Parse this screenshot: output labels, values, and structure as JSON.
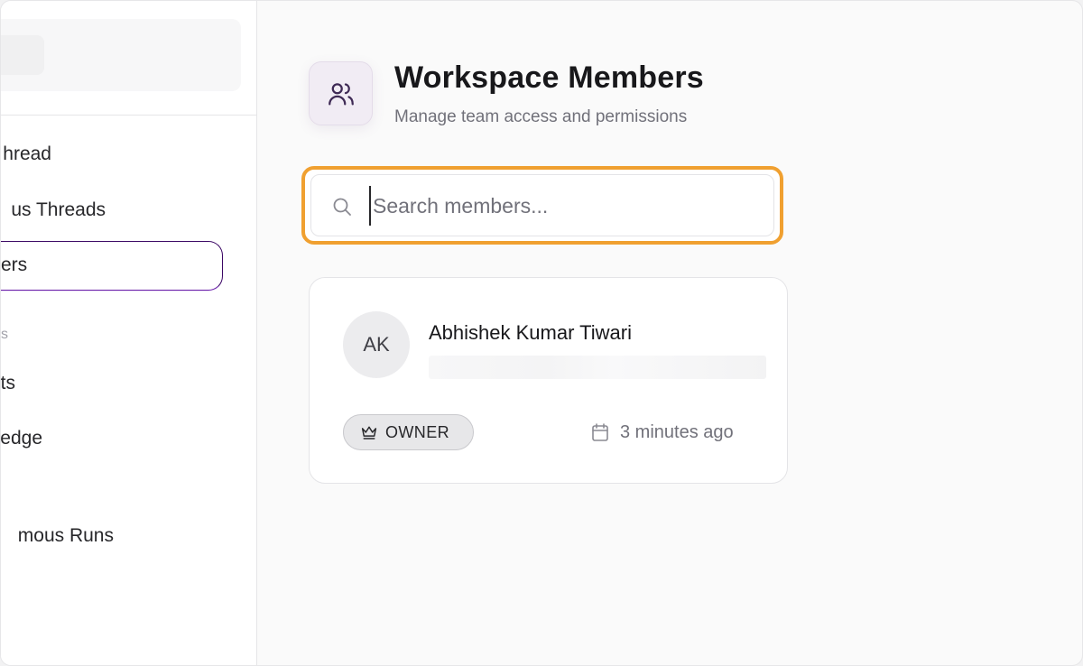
{
  "sidebar": {
    "items": [
      {
        "label": "hread"
      },
      {
        "label": "us Threads"
      },
      {
        "label": "ers"
      },
      {
        "label": "s"
      },
      {
        "label": "ts"
      },
      {
        "label": "edge"
      },
      {
        "label": "mous Runs"
      }
    ]
  },
  "header": {
    "icon": "users-icon",
    "title": "Workspace Members",
    "subtitle": "Manage team access and permissions"
  },
  "search": {
    "placeholder": "Search members...",
    "value": "",
    "focus_color": "#f0a030"
  },
  "members": [
    {
      "initials": "AK",
      "name": "Abhishek Kumar Tiwari",
      "role": "OWNER",
      "role_icon": "crown-icon",
      "joined": "3 minutes ago",
      "joined_icon": "calendar-icon"
    }
  ],
  "colors": {
    "accent": "#3b0764",
    "header_icon_bg": "#f1ecf4"
  }
}
